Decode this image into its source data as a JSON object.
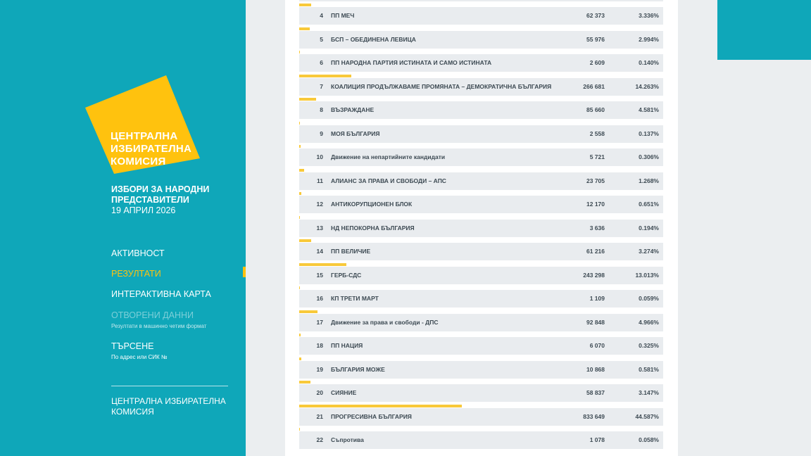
{
  "logo": {
    "line1": "ЦЕНТРАЛНА",
    "line2": "ИЗБИРАТЕЛНА",
    "line3": "КОМИСИЯ",
    "color": "#ffc20e"
  },
  "election": {
    "title": "ИЗБОРИ ЗА НАРОДНИ ПРЕДСТАВИТЕЛИ",
    "date": "19 АПРИЛ 2026"
  },
  "nav": {
    "activity": "АКТИВНОСТ",
    "results": "РЕЗУЛТАТИ",
    "interactive_map": "ИНТЕРАКТИВНА КАРТА",
    "open_data": "ОТВОРЕНИ ДАННИ",
    "open_data_sub": "Резултати в машинно четим формат",
    "search": "ТЪРСЕНЕ",
    "search_sub": "По адрес или СИК №",
    "cik": "ЦЕНТРАЛНА ИЗБИРАТЕЛНА КОМИСИЯ"
  },
  "colors": {
    "sidebar": "#0fa7b9",
    "accent": "#ffc20e",
    "bar": "#f8c93a"
  },
  "results": [
    {
      "num": "4",
      "name": "ПП МЕЧ",
      "votes": "62 373",
      "pct": "3.336%",
      "share": 3.336
    },
    {
      "num": "5",
      "name": "БСП – ОБЕДИНЕНА ЛЕВИЦА",
      "votes": "55 976",
      "pct": "2.994%",
      "share": 2.994
    },
    {
      "num": "6",
      "name": "ПП НАРОДНА ПАРТИЯ ИСТИНАТА И САМО ИСТИНАТА",
      "votes": "2 609",
      "pct": "0.140%",
      "share": 0.14
    },
    {
      "num": "7",
      "name": "КОАЛИЦИЯ ПРОДЪЛЖАВАМЕ ПРОМЯНАТА – ДЕМОКРАТИЧНА БЪЛГАРИЯ",
      "votes": "266 681",
      "pct": "14.263%",
      "share": 14.263
    },
    {
      "num": "8",
      "name": "ВЪЗРАЖДАНЕ",
      "votes": "85 660",
      "pct": "4.581%",
      "share": 4.581
    },
    {
      "num": "9",
      "name": "МОЯ БЪЛГАРИЯ",
      "votes": "2 558",
      "pct": "0.137%",
      "share": 0.137
    },
    {
      "num": "10",
      "name": "Движение на непартийните кандидати",
      "votes": "5 721",
      "pct": "0.306%",
      "share": 0.306
    },
    {
      "num": "11",
      "name": "АЛИАНС ЗА ПРАВА И СВОБОДИ – АПС",
      "votes": "23 705",
      "pct": "1.268%",
      "share": 1.268
    },
    {
      "num": "12",
      "name": "АНТИКОРУПЦИОНЕН БЛОК",
      "votes": "12 170",
      "pct": "0.651%",
      "share": 0.651
    },
    {
      "num": "13",
      "name": "НД НЕПОКОРНА БЪЛГАРИЯ",
      "votes": "3 636",
      "pct": "0.194%",
      "share": 0.194
    },
    {
      "num": "14",
      "name": "ПП ВЕЛИЧИЕ",
      "votes": "61 216",
      "pct": "3.274%",
      "share": 3.274
    },
    {
      "num": "15",
      "name": "ГЕРБ-СДС",
      "votes": "243 298",
      "pct": "13.013%",
      "share": 13.013
    },
    {
      "num": "16",
      "name": "КП ТРЕТИ МАРТ",
      "votes": "1 109",
      "pct": "0.059%",
      "share": 0.059
    },
    {
      "num": "17",
      "name": "Движение за права и свободи - ДПС",
      "votes": "92 848",
      "pct": "4.966%",
      "share": 4.966
    },
    {
      "num": "18",
      "name": "ПП НАЦИЯ",
      "votes": "6 070",
      "pct": "0.325%",
      "share": 0.325
    },
    {
      "num": "19",
      "name": "БЪЛГАРИЯ МОЖЕ",
      "votes": "10 868",
      "pct": "0.581%",
      "share": 0.581
    },
    {
      "num": "20",
      "name": "СИЯНИЕ",
      "votes": "58 837",
      "pct": "3.147%",
      "share": 3.147
    },
    {
      "num": "21",
      "name": "ПРОГРЕСИВНА БЪЛГАРИЯ",
      "votes": "833 649",
      "pct": "44.587%",
      "share": 44.587
    },
    {
      "num": "22",
      "name": "Съпротива",
      "votes": "1 078",
      "pct": "0.058%",
      "share": 0.058
    }
  ]
}
